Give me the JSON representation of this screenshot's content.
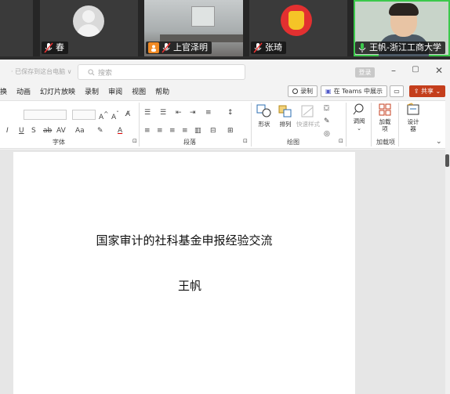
{
  "participants": [
    {
      "name": "",
      "avatar": "video-feed"
    },
    {
      "name": "",
      "avatar": "default-gray"
    },
    {
      "name": "春",
      "avatar": "none"
    },
    {
      "name": "上官泽明",
      "avatar": "camera-room"
    },
    {
      "name": "张琦",
      "avatar": "ironman"
    },
    {
      "name": "王帆-浙江工商大学",
      "avatar": "camera-person",
      "active_speaker": true
    }
  ],
  "titlebar": {
    "save_status": "· 已保存到这台电脑 ∨",
    "search_placeholder": "搜索",
    "login_label": "登录"
  },
  "menubar": {
    "items": [
      "换",
      "动画",
      "幻灯片放映",
      "录制",
      "审阅",
      "视图",
      "帮助"
    ],
    "record_label": "录制",
    "teams_label": "在 Teams 中展示",
    "share_label": "共享"
  },
  "ribbon": {
    "groups": {
      "font": "字体",
      "paragraph": "段落",
      "drawing": "绘图",
      "addins": "加载项"
    },
    "buttons": {
      "shape": "形状",
      "arrange": "排列",
      "quick_style": "快速样式",
      "dictate": "调阅",
      "addins": "加载项",
      "designer": "设计器"
    }
  },
  "slide": {
    "title": "国家审计的社科基金申报经验交流",
    "author": "王帆"
  },
  "colors": {
    "share_button": "#c43e1c",
    "active_speaker_border": "#3cc94c"
  }
}
